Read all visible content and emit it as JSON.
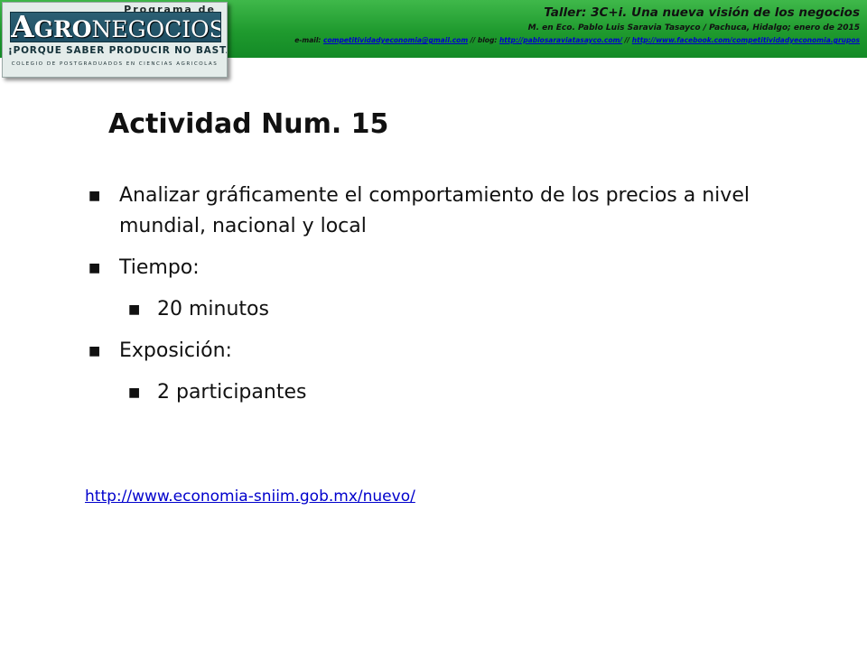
{
  "header": {
    "workshop_title": "Taller: 3C+i. Una nueva visión de los negocios",
    "author_line": "M. en Eco. Pablo Luis Saravia Tasayco / Pachuca, Hidalgo; enero de 2015",
    "email_prefix": "e-mail: ",
    "email": "competitividadyeconomia@gmail.com",
    "blog_prefix": " // blog: ",
    "blog": "http://pablosaraviatasayco.com/",
    "facebook_prefix": " // ",
    "facebook": "http://www.facebook.com/competitividadyeconomia.grupos",
    "banner_color": "#1f9a2e"
  },
  "logo": {
    "program": "Programa de",
    "brand_a": "A",
    "brand_gro": "GRO",
    "brand_rest": "NEGOCIOS",
    "slogan": "¡PORQUE SABER PRODUCIR NO BASTA!",
    "college": "COLEGIO DE POSTGRADUADOS EN CIENCIAS AGRICOLAS"
  },
  "slide": {
    "title": "Actividad Num. 15",
    "bullets": [
      {
        "level": 1,
        "text": "Analizar gráficamente el comportamiento de los precios a nivel mundial, nacional y local"
      },
      {
        "level": 1,
        "text": "Tiempo:"
      },
      {
        "level": 2,
        "text": "20 minutos"
      },
      {
        "level": 1,
        "text": "Exposición:"
      },
      {
        "level": 2,
        "text": "2 participantes"
      }
    ],
    "bullet_glyph": "■",
    "source_link": "http://www.economia-sniim.gob.mx/nuevo/",
    "link_color": "#0000cc"
  }
}
